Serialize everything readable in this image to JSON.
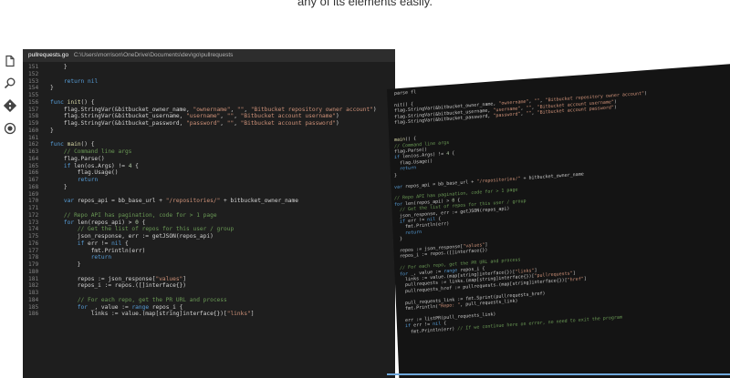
{
  "caption": "any of its elements easily.",
  "editor": {
    "tab_file": "pullrequests.go",
    "tab_path": "C:\\Users\\morrison\\OneDrive\\Documents\\dev\\go\\pullrequests"
  },
  "activity_icons": [
    "files-icon",
    "search-icon",
    "source-control-icon",
    "debug-icon"
  ],
  "code_lines": [
    {
      "n": "151",
      "t": "    }"
    },
    {
      "n": "152",
      "t": ""
    },
    {
      "n": "153",
      "t": "    return nil"
    },
    {
      "n": "154",
      "t": "}"
    },
    {
      "n": "155",
      "t": ""
    },
    {
      "n": "156",
      "t": "func init() {"
    },
    {
      "n": "157",
      "t": "    flag.StringVar(&bitbucket_owner_name, \"ownername\", \"\", \"Bitbucket repository owner account\")"
    },
    {
      "n": "158",
      "t": "    flag.StringVar(&bitbucket_username, \"username\", \"\", \"Bitbucket account username\")"
    },
    {
      "n": "159",
      "t": "    flag.StringVar(&bitbucket_password, \"password\", \"\", \"Bitbucket account password\")"
    },
    {
      "n": "160",
      "t": "}"
    },
    {
      "n": "161",
      "t": ""
    },
    {
      "n": "162",
      "t": "func main() {"
    },
    {
      "n": "163",
      "t": "    // Command line args"
    },
    {
      "n": "164",
      "t": "    flag.Parse()"
    },
    {
      "n": "165",
      "t": "    if len(os.Args) != 4 {"
    },
    {
      "n": "166",
      "t": "        flag.Usage()"
    },
    {
      "n": "167",
      "t": "        return"
    },
    {
      "n": "168",
      "t": "    }"
    },
    {
      "n": "169",
      "t": ""
    },
    {
      "n": "170",
      "t": "    var repos_api = bb_base_url + \"/repositories/\" + bitbucket_owner_name"
    },
    {
      "n": "171",
      "t": ""
    },
    {
      "n": "172",
      "t": "    // Repo API has pagination, code for > 1 page"
    },
    {
      "n": "173",
      "t": "    for len(repos_api) > 0 {"
    },
    {
      "n": "174",
      "t": "        // Get the list of repos for this user / group"
    },
    {
      "n": "175",
      "t": "        json_response, err := getJSON(repos_api)"
    },
    {
      "n": "176",
      "t": "        if err != nil {"
    },
    {
      "n": "177",
      "t": "            fmt.Println(err)"
    },
    {
      "n": "178",
      "t": "            return"
    },
    {
      "n": "179",
      "t": "        }"
    },
    {
      "n": "180",
      "t": ""
    },
    {
      "n": "181",
      "t": "        repos := json_response[\"values\"]"
    },
    {
      "n": "182",
      "t": "        repos_i := repos.([]interface{})"
    },
    {
      "n": "183",
      "t": ""
    },
    {
      "n": "184",
      "t": "        // For each repo, get the PR URL and process"
    },
    {
      "n": "185",
      "t": "        for _, value := range repos_i {"
    },
    {
      "n": "186",
      "t": "            links := value.(map[string]interface{})[\"links\"]"
    }
  ],
  "skewed_lines": [
    "parse fl",
    "",
    "nit() {",
    "flag.StringVar(&bitbucket_owner_name, \"ownername\", \"\", \"Bitbucket repository owner account\")",
    "flag.StringVar(&bitbucket_username, \"username\", \"\", \"Bitbucket account username\")",
    "flag.StringVar(&bitbucket_password, \"password\", \"\", \"Bitbucket account password\")",
    "",
    "",
    "main() {",
    "// Command line args",
    "flag.Parse()",
    "if len(os.Args) != 4 {",
    "  flag.Usage()",
    "  return",
    "}",
    "",
    "var repos_api = bb_base_url + \"/repositories/\" + bitbucket_owner_name",
    "",
    "// Repo API has pagination, code for > 1 page",
    "for len(repos_api) > 0 {",
    "  // Get the list of repos for this user / group",
    "  json_response, err := getJSON(repos_api)",
    "  if err != nil {",
    "    fmt.Println(err)",
    "    return",
    "  }",
    "",
    "  repos := json_response[\"values\"]",
    "  repos_i := repos.([]interface{})",
    "",
    "  // For each repo, get the PR URL and process",
    "  for _, value := range repos_i {",
    "    links := value.(map[string]interface{})[\"links\"]",
    "    pullrequests := links.(map[string]interface{})[\"pullrequests\"]",
    "    pullrequests_href := pullrequests.(map[string]interface{})[\"href\"]",
    "",
    "    pull_requests_link := fmt.Sprint(pullrequests_href)",
    "    fmt.Println(\"Repo: \", pull_requests_link)",
    "",
    "    err := listPR(pull_requests_link)",
    "    if err != nil {",
    "      fmt.Println(err) // If we continue here on error, no need to exit the program"
  ],
  "colors": {
    "editor_bg": "#1e1e1e",
    "tabbar_bg": "#2d2d2d",
    "line_number": "#858585",
    "keyword": "#569cd6",
    "comment": "#6a9955",
    "string": "#ce9178"
  }
}
